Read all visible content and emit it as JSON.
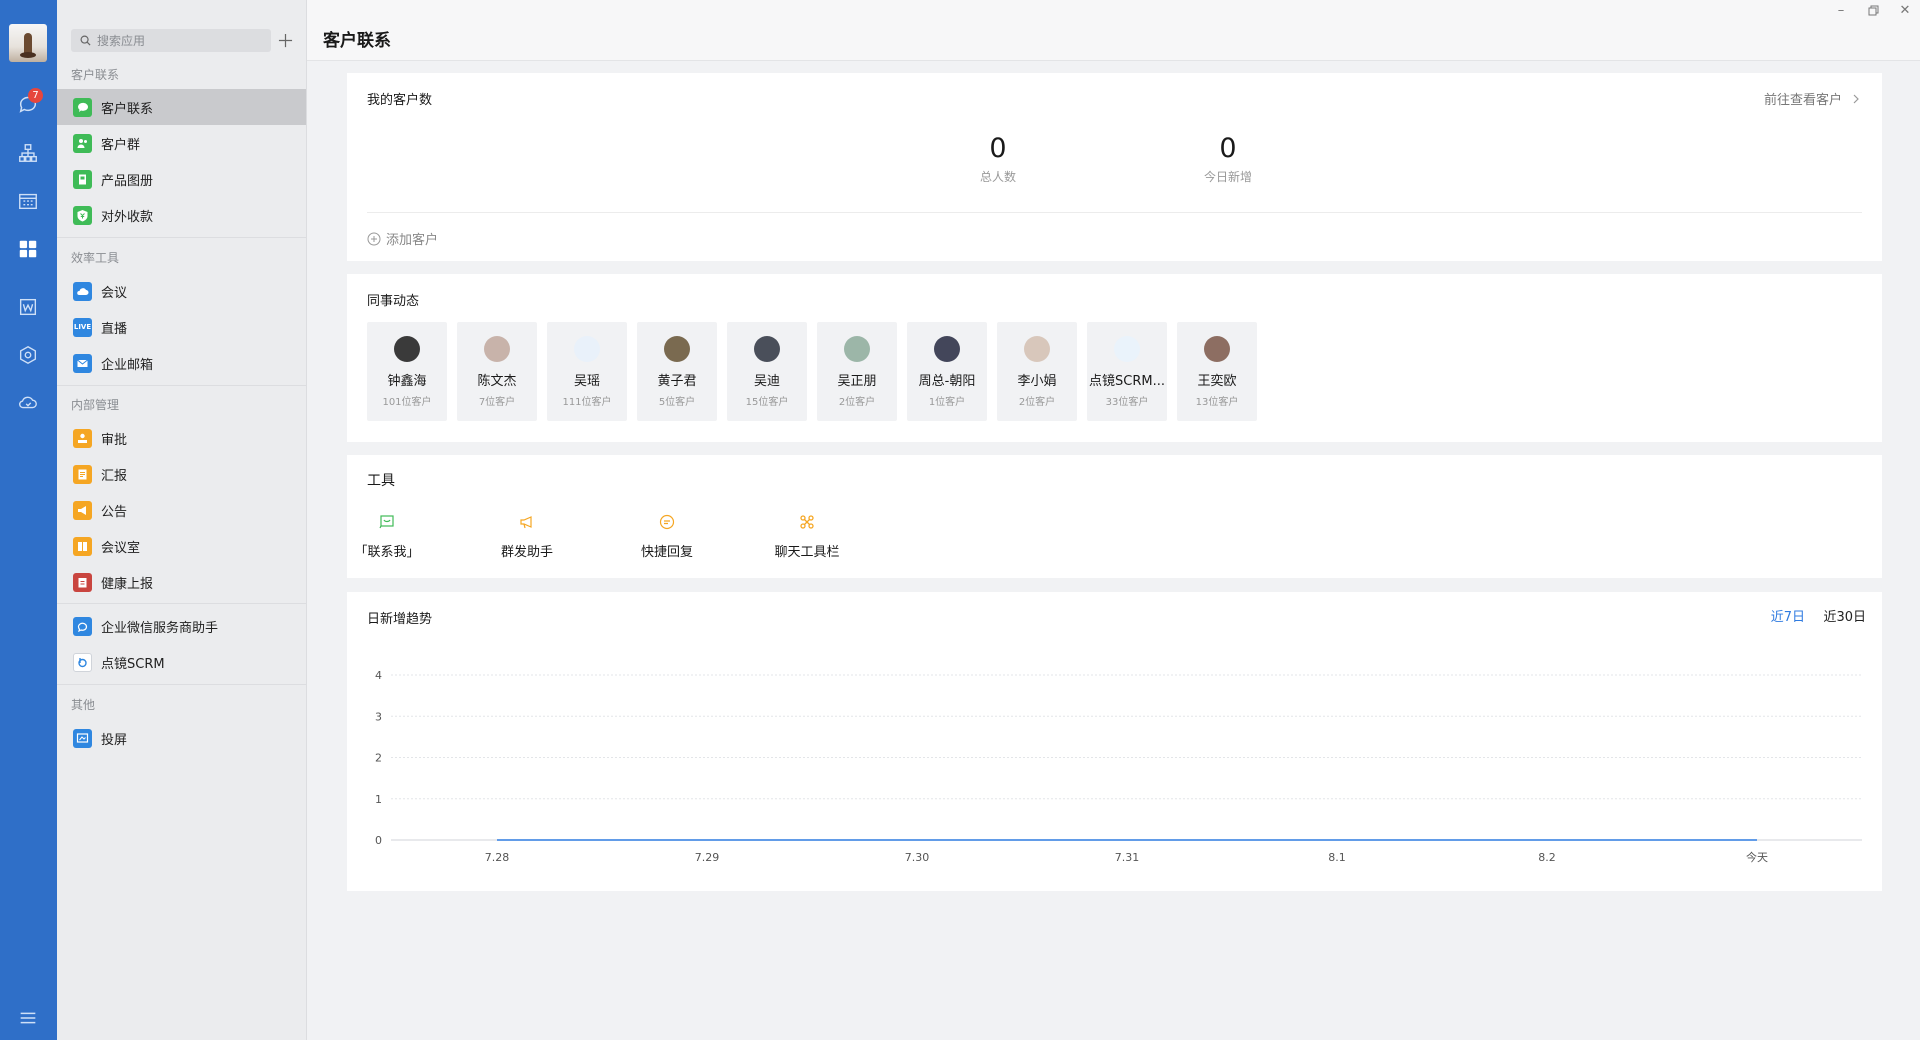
{
  "rail": {
    "badge_count": "7",
    "icons": [
      "chat-icon",
      "org-icon",
      "calendar-icon",
      "workbench-icon",
      "doc-icon",
      "cube-icon",
      "cloud-icon",
      "menu-icon"
    ]
  },
  "sidebar": {
    "search_placeholder": "搜索应用",
    "sections": [
      {
        "title": "客户联系",
        "items": [
          {
            "label": "客户联系",
            "color": "#3fbb57",
            "icon": "chat-bubble-icon",
            "active": true
          },
          {
            "label": "客户群",
            "color": "#3fbb57",
            "icon": "group-icon"
          },
          {
            "label": "产品图册",
            "color": "#3fbb57",
            "icon": "album-icon"
          },
          {
            "label": "对外收款",
            "color": "#3fbb57",
            "icon": "payment-icon"
          }
        ]
      },
      {
        "title": "效率工具",
        "items": [
          {
            "label": "会议",
            "color": "#2f87e0",
            "icon": "meeting-icon"
          },
          {
            "label": "直播",
            "color": "#2f87e0",
            "icon": "live-icon",
            "badge_text": "LIVE"
          },
          {
            "label": "企业邮箱",
            "color": "#2f87e0",
            "icon": "mail-icon"
          }
        ]
      },
      {
        "title": "内部管理",
        "items": [
          {
            "label": "审批",
            "color": "#f5a623",
            "icon": "approval-icon"
          },
          {
            "label": "汇报",
            "color": "#f5a623",
            "icon": "report-icon"
          },
          {
            "label": "公告",
            "color": "#f5a623",
            "icon": "announce-icon"
          },
          {
            "label": "会议室",
            "color": "#f5a623",
            "icon": "room-icon"
          },
          {
            "label": "健康上报",
            "color": "#c9453f",
            "icon": "health-icon"
          }
        ]
      },
      {
        "title": "",
        "items": [
          {
            "label": "企业微信服务商助手",
            "color": "#2f87e0",
            "icon": "service-icon"
          },
          {
            "label": "点镜SCRM",
            "color": "#ffffff",
            "icon": "scrm-icon"
          }
        ]
      },
      {
        "title": "其他",
        "items": [
          {
            "label": "投屏",
            "color": "#2f87e0",
            "icon": "cast-icon"
          }
        ]
      }
    ]
  },
  "header": {
    "title": "客户联系"
  },
  "customers": {
    "title": "我的客户数",
    "link": "前往查看客户",
    "total": {
      "value": "0",
      "label": "总人数"
    },
    "today": {
      "value": "0",
      "label": "今日新增"
    },
    "add_label": "添加客户"
  },
  "colleagues": {
    "title": "同事动态",
    "items": [
      {
        "name": "钟鑫海",
        "count": "101位客户",
        "avatar_color": "#3a3a3a"
      },
      {
        "name": "陈文杰",
        "count": "7位客户",
        "avatar_color": "#c8b3aa"
      },
      {
        "name": "吴瑶",
        "count": "111位客户",
        "avatar_color": "#e9f1fa"
      },
      {
        "name": "黄子君",
        "count": "5位客户",
        "avatar_color": "#7a6a50"
      },
      {
        "name": "吴迪",
        "count": "15位客户",
        "avatar_color": "#4a4f5a"
      },
      {
        "name": "吴正朋",
        "count": "2位客户",
        "avatar_color": "#9cb6a8"
      },
      {
        "name": "周总-朝阳",
        "count": "1位客户",
        "avatar_color": "#43465a"
      },
      {
        "name": "李小娟",
        "count": "2位客户",
        "avatar_color": "#d8c7bb"
      },
      {
        "name": "点镜SCRM...",
        "count": "33位客户",
        "avatar_color": "#eaf3fb"
      },
      {
        "name": "王奕欧",
        "count": "13位客户",
        "avatar_color": "#8d6e62"
      }
    ]
  },
  "tools": {
    "title": "工具",
    "items": [
      {
        "label": "「联系我」",
        "icon": "contact-me-icon",
        "color": "#3fbb57"
      },
      {
        "label": "群发助手",
        "icon": "megaphone-icon",
        "color": "#f5a623"
      },
      {
        "label": "快捷回复",
        "icon": "quick-reply-icon",
        "color": "#f5a623"
      },
      {
        "label": "聊天工具栏",
        "icon": "chat-toolbar-icon",
        "color": "#f5a623"
      }
    ]
  },
  "trend": {
    "title": "日新增趋势",
    "ranges": [
      "近7日",
      "近30日"
    ],
    "active_range": "近7日",
    "accent": "#2f7be0"
  },
  "chart_data": {
    "type": "line",
    "categories": [
      "7.28",
      "7.29",
      "7.30",
      "7.31",
      "8.1",
      "8.2",
      "今天"
    ],
    "series": [
      {
        "values": [
          0,
          0,
          0,
          0,
          0,
          0,
          0
        ]
      }
    ],
    "yticks": [
      0,
      1,
      2,
      3,
      4
    ],
    "ylim": [
      0,
      4
    ],
    "grid": true
  }
}
